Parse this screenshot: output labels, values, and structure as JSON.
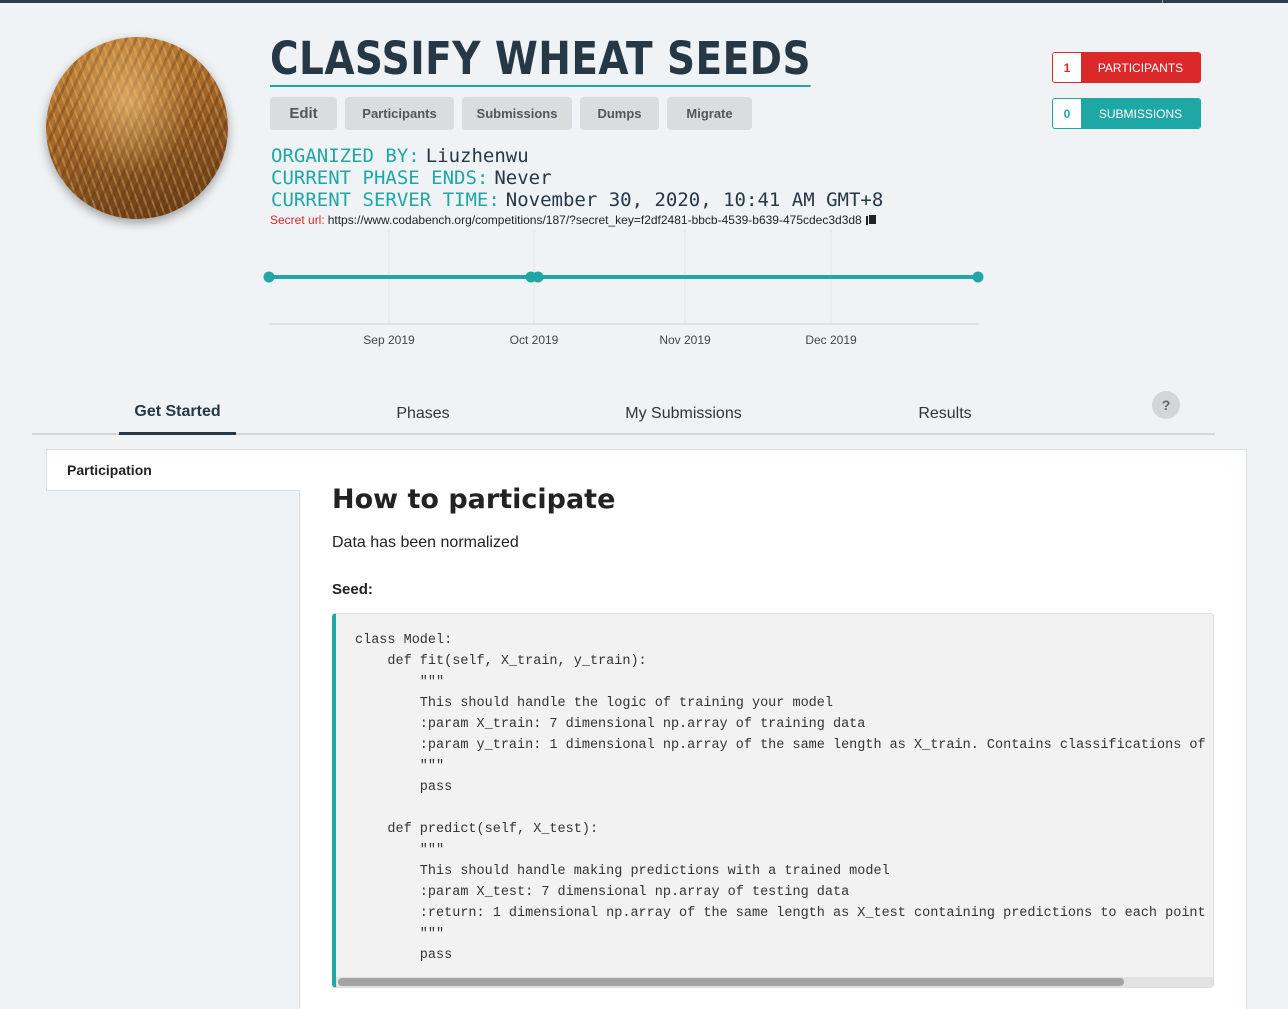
{
  "competition": {
    "title": "CLASSIFY WHEAT SEEDS",
    "image_alt": "wheat ears photo"
  },
  "admin_buttons": {
    "edit": "Edit",
    "participants": "Participants",
    "submissions": "Submissions",
    "dumps": "Dumps",
    "migrate": "Migrate"
  },
  "meta": {
    "organized_by_label": "ORGANIZED BY:",
    "organized_by_value": "Liuzhenwu",
    "phase_ends_label": "CURRENT PHASE ENDS:",
    "phase_ends_value": "Never",
    "server_time_label": "CURRENT SERVER TIME:",
    "server_time_value": "November 30, 2020, 10:41 AM GMT+8",
    "secret_label": "Secret url:",
    "secret_url": "https://www.codabench.org/competitions/187/?secret_key=f2df2481-bbcb-4539-b639-475cdec3d3d8"
  },
  "stats": {
    "participants_count": "1",
    "participants_label": "PARTICIPANTS",
    "submissions_count": "0",
    "submissions_label": "SUBMISSIONS"
  },
  "colors": {
    "accent_teal": "#1fa7a5",
    "danger_red": "#db2828",
    "title_navy": "#263746"
  },
  "timeline": {
    "tick_labels": [
      "Sep 2019",
      "Oct 2019",
      "Nov 2019",
      "Dec 2019"
    ]
  },
  "tabs": {
    "get_started": "Get Started",
    "phases": "Phases",
    "my_submissions": "My Submissions",
    "results": "Results",
    "help": "?"
  },
  "sidebar": {
    "items": [
      {
        "label": "Participation"
      }
    ]
  },
  "content": {
    "heading": "How to participate",
    "paragraph": "Data has been normalized",
    "seed_label": "Seed:",
    "code": "class Model:\n    def fit(self, X_train, y_train):\n        \"\"\"\n        This should handle the logic of training your model\n        :param X_train: 7 dimensional np.array of training data\n        :param y_train: 1 dimensional np.array of the same length as X_train. Contains classifications of\n        \"\"\"\n        pass\n\n    def predict(self, X_test):\n        \"\"\"\n        This should handle making predictions with a trained model\n        :param X_test: 7 dimensional np.array of testing data\n        :return: 1 dimensional np.array of the same length as X_test containing predictions to each point\n        \"\"\"\n        pass"
  }
}
